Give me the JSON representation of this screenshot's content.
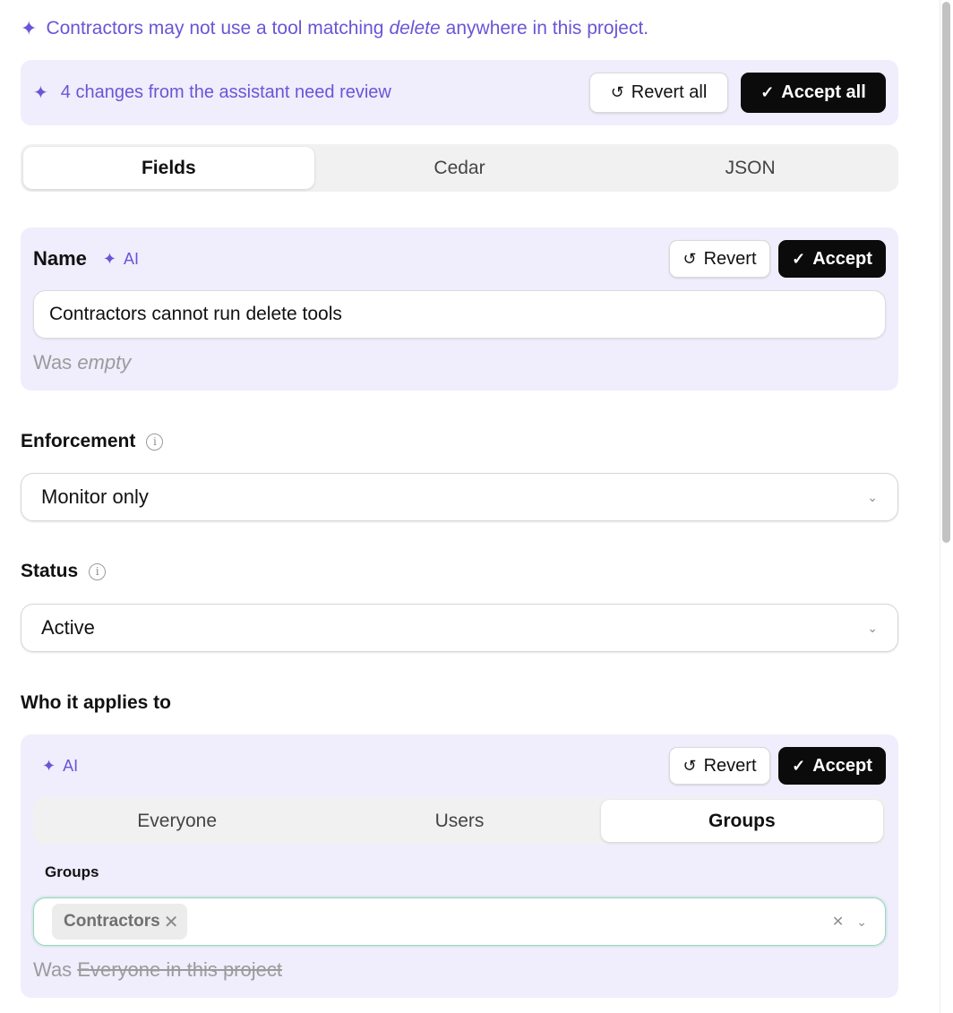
{
  "summary": {
    "prefix": "Contractors may not use a tool matching",
    "keyword": "delete",
    "suffix": "anywhere in this project."
  },
  "review_banner": {
    "message": "4 changes from the assistant need review",
    "revert_all_label": "Revert all",
    "accept_all_label": "Accept all"
  },
  "view_tabs": [
    {
      "label": "Fields",
      "active": true
    },
    {
      "label": "Cedar",
      "active": false
    },
    {
      "label": "JSON",
      "active": false
    }
  ],
  "ai_tag": "AI",
  "revert_label": "Revert",
  "accept_label": "Accept",
  "was_prefix": "Was",
  "name_field": {
    "label": "Name",
    "value": "Contractors cannot run delete tools",
    "previous": "empty"
  },
  "enforcement": {
    "label": "Enforcement",
    "value": "Monitor only"
  },
  "status": {
    "label": "Status",
    "value": "Active"
  },
  "who": {
    "label": "Who it applies to",
    "tabs": [
      {
        "label": "Everyone",
        "active": false
      },
      {
        "label": "Users",
        "active": false
      },
      {
        "label": "Groups",
        "active": true
      }
    ],
    "groups_label": "Groups",
    "selected_groups": [
      "Contractors"
    ],
    "previous": "Everyone in this project"
  },
  "icons": {
    "sparkle": "sparkle-icon",
    "revert": "revert-icon",
    "accept": "check-icon",
    "info": "info-icon",
    "chevron": "chevron-down-icon",
    "remove": "close-icon",
    "clear": "clear-icon"
  },
  "colors": {
    "ai_accent": "#6a55d6",
    "ai_card_bg": "#f0edfd",
    "primary_button": "#0b0b0b",
    "focus_border": "#97d6bb"
  }
}
